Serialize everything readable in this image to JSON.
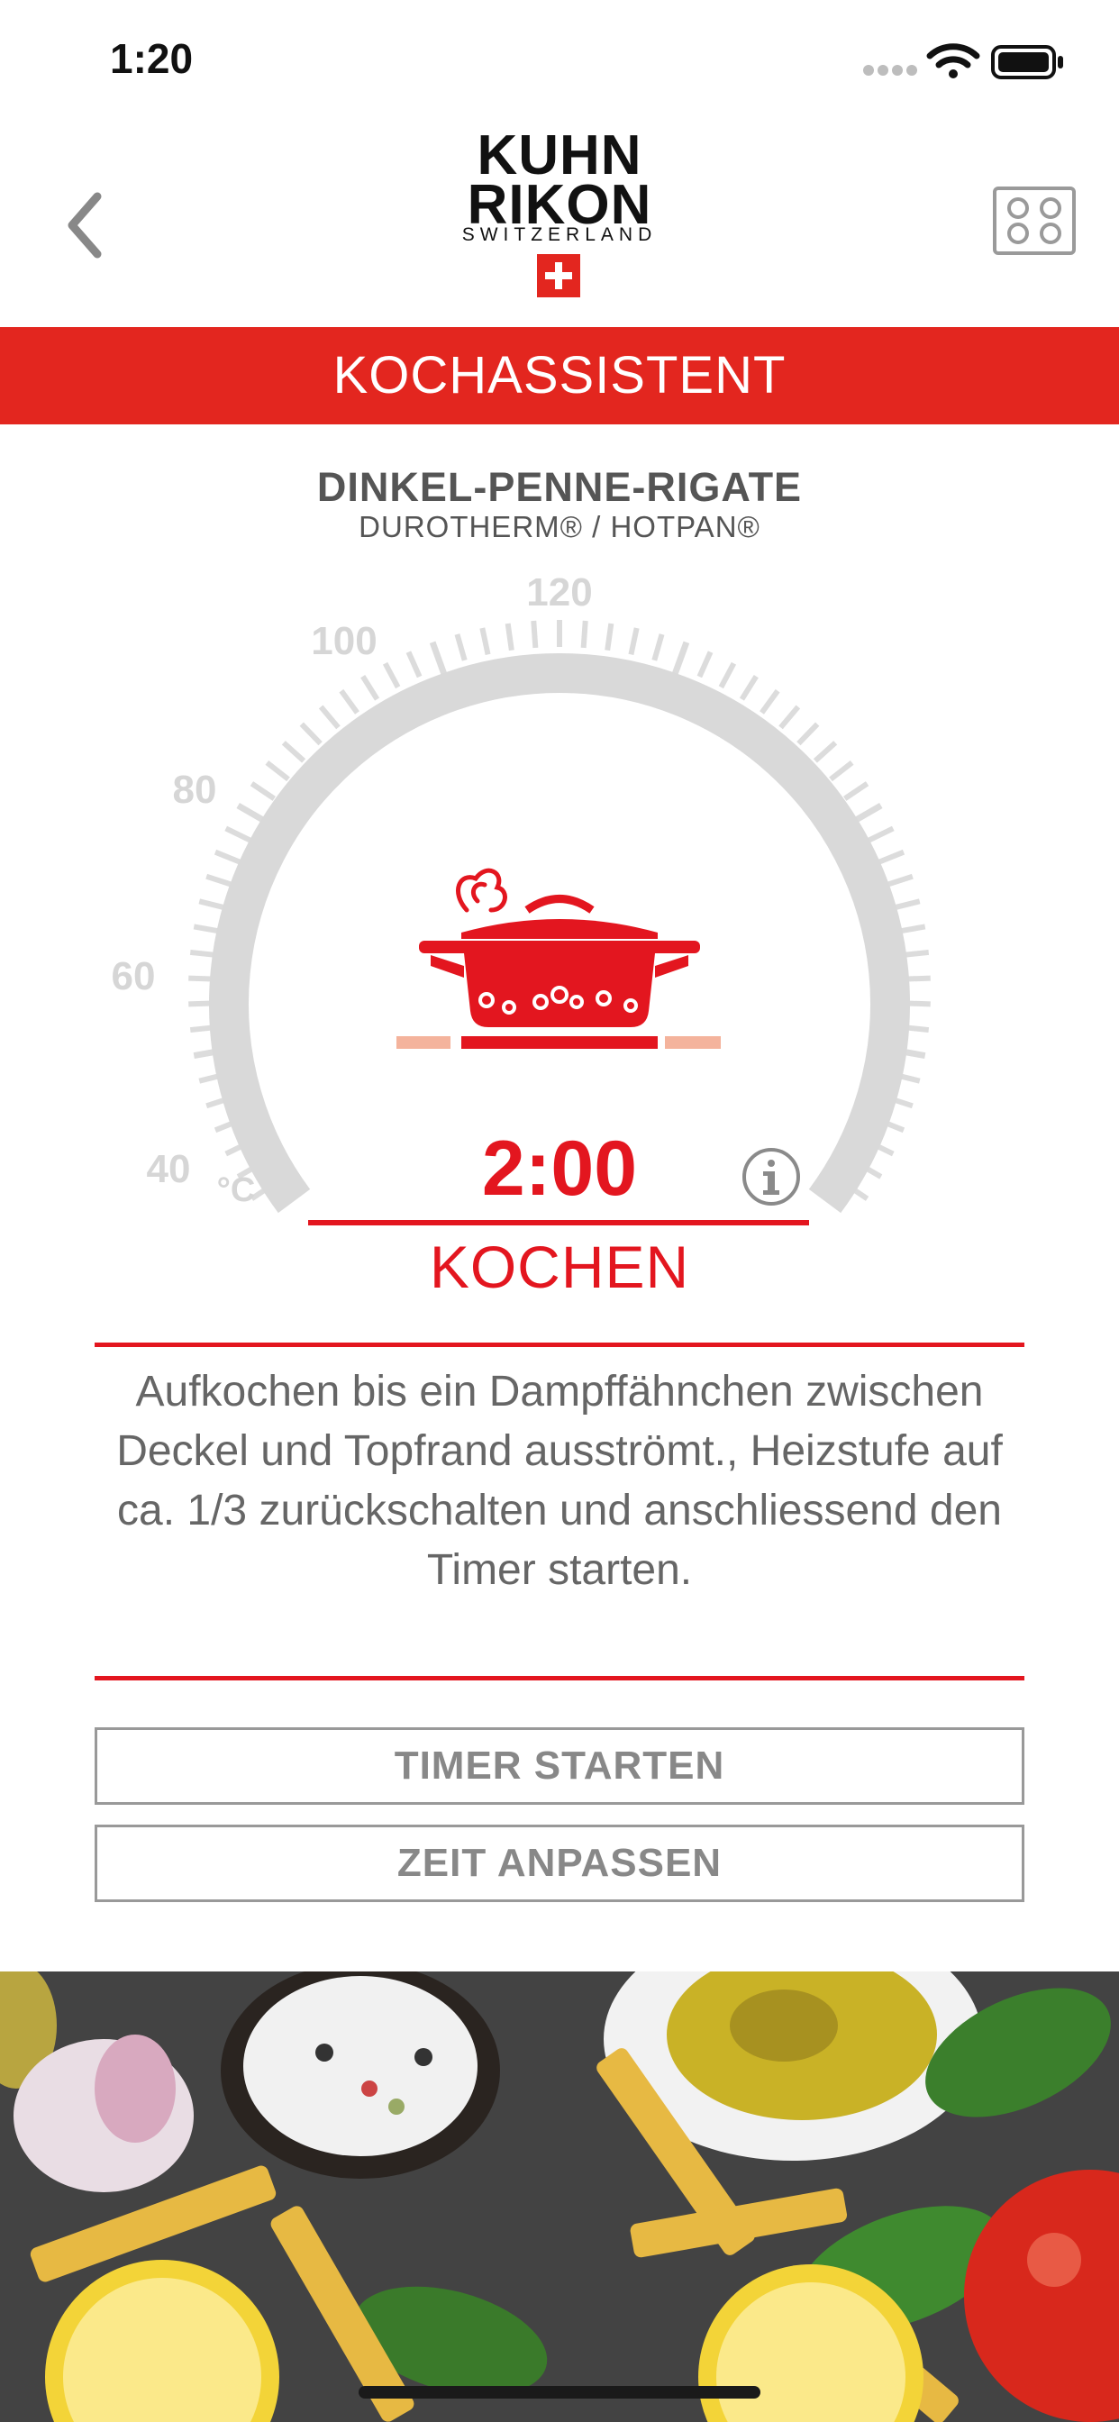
{
  "status_bar": {
    "time": "1:20"
  },
  "header": {
    "logo": {
      "line1": "KUHN",
      "line2": "RIKON",
      "line3": "SWITZERLAND"
    },
    "back_icon": "chevron-left-icon",
    "cooktop_icon": "cooktop-icon"
  },
  "banner": {
    "title": "KOCHASSISTENT"
  },
  "recipe": {
    "name": "DINKEL-PENNE-RIGATE",
    "cookware": "DUROTHERM® / HOTPAN®"
  },
  "gauge": {
    "unit": "°C",
    "tick_labels": [
      "40",
      "60",
      "80",
      "100",
      "120"
    ],
    "icon": "boiling-pot-icon"
  },
  "timer": {
    "value": "2:00",
    "phase": "KOCHEN"
  },
  "instructions": "Aufkochen bis ein Dampffähnchen zwischen Deckel und Topfrand ausströmt., Heizstufe auf ca. 1/3 zurückschalten und anschliessend den Timer starten.",
  "buttons": {
    "start_timer": "TIMER STARTEN",
    "adjust_time": "ZEIT ANPASSEN"
  },
  "colors": {
    "accent": "#E3261F",
    "gauge_gray": "#D9D9D9",
    "text_gray": "#666666"
  }
}
